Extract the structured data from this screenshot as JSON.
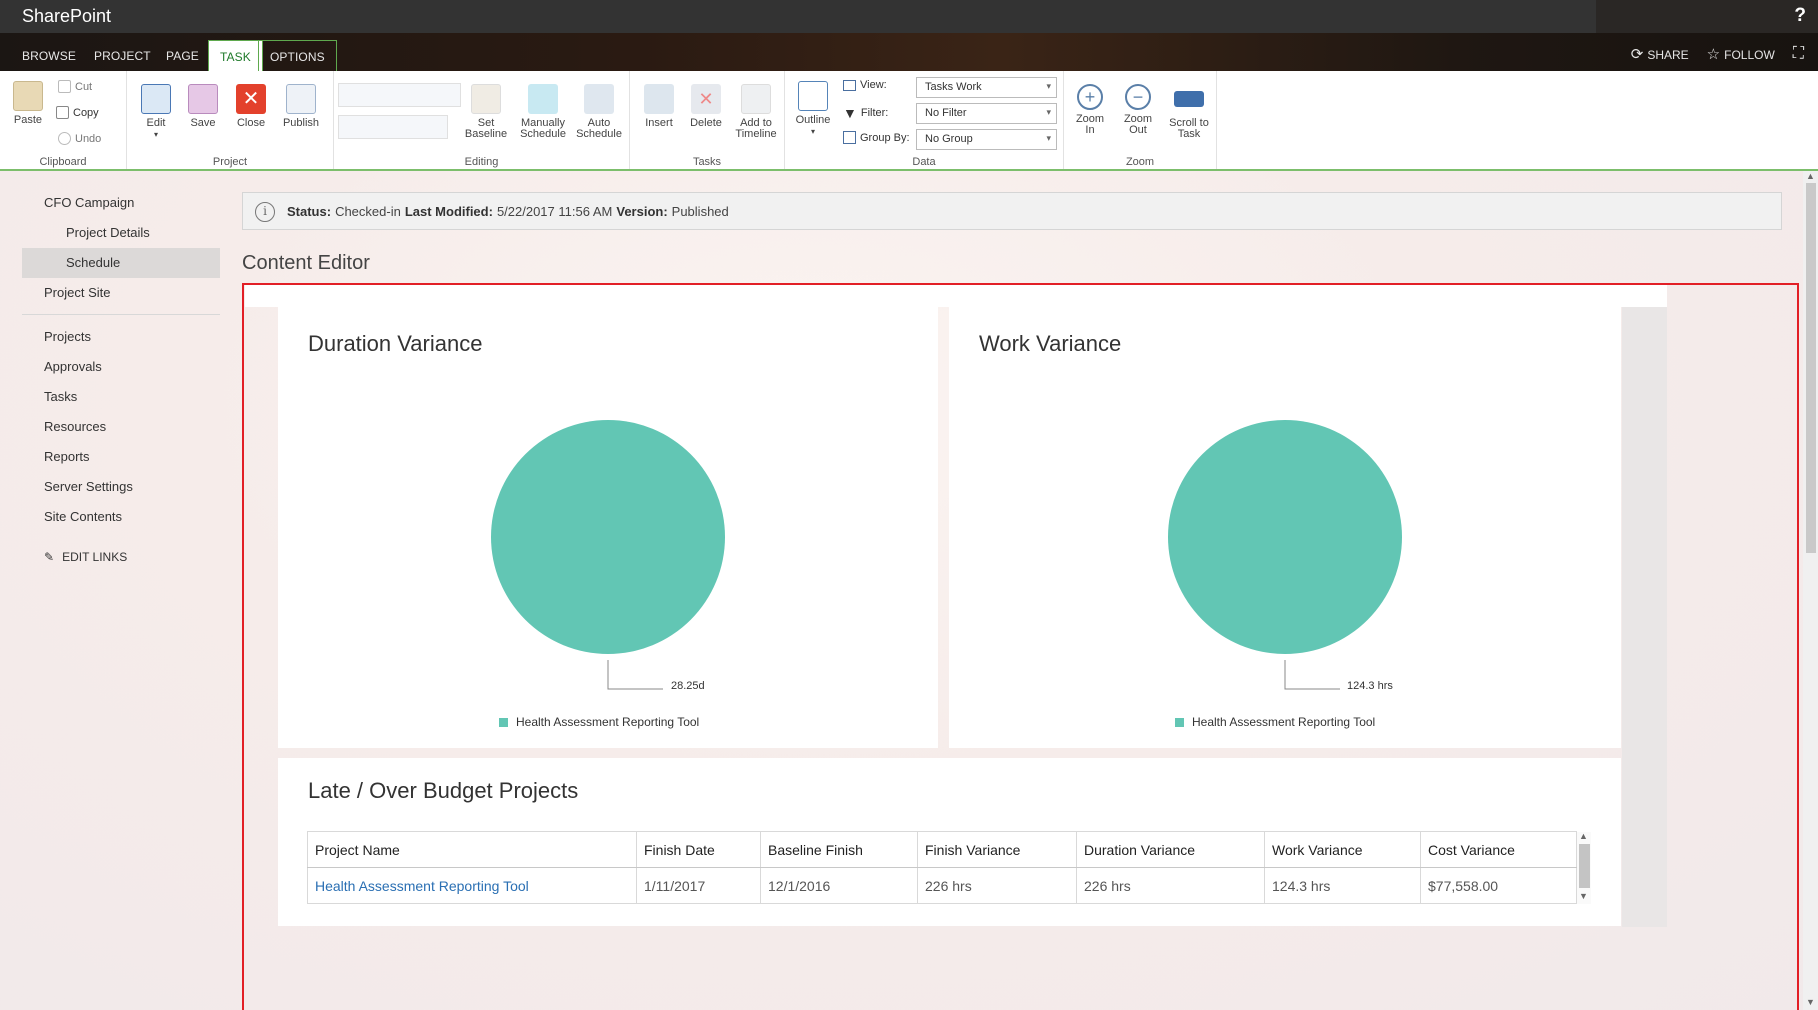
{
  "suitebar": {
    "brand": "SharePoint",
    "help": "?"
  },
  "tabs": [
    "BROWSE",
    "PROJECT",
    "PAGE",
    "TASK",
    "OPTIONS"
  ],
  "top_actions": {
    "share": "SHARE",
    "follow": "FOLLOW"
  },
  "ribbon": {
    "clipboard": {
      "label": "Clipboard",
      "paste": "Paste",
      "cut": "Cut",
      "copy": "Copy",
      "undo": "Undo"
    },
    "project": {
      "label": "Project",
      "edit": "Edit",
      "save": "Save",
      "close": "Close",
      "publish": "Publish"
    },
    "editing": {
      "label": "Editing",
      "set_baseline": [
        "Set",
        "Baseline"
      ],
      "manually_schedule": [
        "Manually",
        "Schedule"
      ],
      "auto_schedule": [
        "Auto",
        "Schedule"
      ]
    },
    "tasks": {
      "label": "Tasks",
      "insert": "Insert",
      "delete": "Delete",
      "add_to_timeline": [
        "Add to",
        "Timeline"
      ]
    },
    "data": {
      "label": "Data",
      "outline": "Outline",
      "view_label": "View:",
      "view_value": "Tasks Work",
      "filter_label": "Filter:",
      "filter_value": "No Filter",
      "groupby_label": "Group By:",
      "groupby_value": "No Group"
    },
    "zoom": {
      "label": "Zoom",
      "zoom_in": [
        "Zoom",
        "In"
      ],
      "zoom_out": [
        "Zoom",
        "Out"
      ],
      "scroll_to_task": [
        "Scroll to",
        "Task"
      ]
    }
  },
  "leftnav": {
    "items": [
      "CFO Campaign",
      "Project Details",
      "Schedule",
      "Project Site"
    ],
    "items2": [
      "Projects",
      "Approvals",
      "Tasks",
      "Resources",
      "Reports",
      "Server Settings",
      "Site Contents"
    ],
    "edit_links": "EDIT LINKS"
  },
  "status": {
    "status_label": "Status:",
    "status_value": "Checked-in",
    "modified_label": "Last Modified:",
    "modified_value": "5/22/2017 11:56 AM",
    "version_label": "Version:",
    "version_value": "Published"
  },
  "content_editor_title": "Content Editor",
  "colors": {
    "pie": "#62c6b4",
    "accent_green": "#5fa94e",
    "frame_red": "#e21f26",
    "link": "#2a6fb3"
  },
  "chart_data": [
    {
      "type": "pie",
      "title": "Duration Variance",
      "categories": [
        "Health Assessment Reporting Tool"
      ],
      "values": [
        28.25
      ],
      "data_labels": [
        "28.25d"
      ],
      "legend": "bottom-center"
    },
    {
      "type": "pie",
      "title": "Work Variance",
      "categories": [
        "Health Assessment Reporting Tool"
      ],
      "values": [
        124.3
      ],
      "data_labels": [
        "124.3 hrs"
      ],
      "legend": "bottom-center"
    }
  ],
  "late_projects": {
    "title": "Late / Over Budget Projects",
    "columns": [
      "Project Name",
      "Finish Date",
      "Baseline Finish",
      "Finish Variance",
      "Duration Variance",
      "Work Variance",
      "Cost Variance"
    ],
    "rows": [
      [
        "Health Assessment Reporting Tool",
        "1/11/2017",
        "12/1/2016",
        "226 hrs",
        "226 hrs",
        "124.3 hrs",
        "$77,558.00"
      ]
    ]
  }
}
